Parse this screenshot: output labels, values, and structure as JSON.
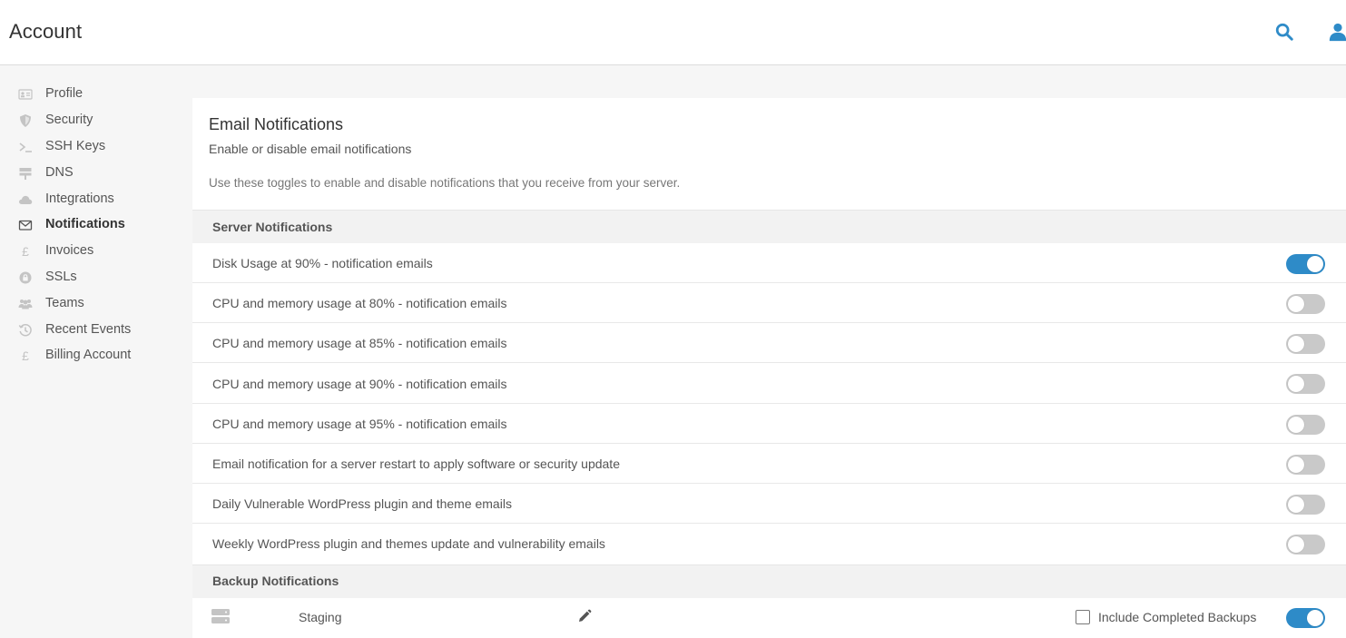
{
  "header": {
    "title": "Account",
    "search_icon": "search-icon",
    "user_icon": "user-icon",
    "accent_color": "#2e8bc8"
  },
  "sidebar": {
    "items": [
      {
        "label": "Profile",
        "icon": "id-card-icon",
        "active": false
      },
      {
        "label": "Security",
        "icon": "shield-icon",
        "active": false
      },
      {
        "label": "SSH Keys",
        "icon": "terminal-icon",
        "active": false
      },
      {
        "label": "DNS",
        "icon": "signpost-icon",
        "active": false
      },
      {
        "label": "Integrations",
        "icon": "cloud-icon",
        "active": false
      },
      {
        "label": "Notifications",
        "icon": "envelope-icon",
        "active": true
      },
      {
        "label": "Invoices",
        "icon": "pound-icon",
        "active": false
      },
      {
        "label": "SSLs",
        "icon": "lock-icon",
        "active": false
      },
      {
        "label": "Teams",
        "icon": "users-icon",
        "active": false
      },
      {
        "label": "Recent Events",
        "icon": "history-icon",
        "active": false
      },
      {
        "label": "Billing Account",
        "icon": "pound-icon",
        "active": false
      }
    ]
  },
  "panel": {
    "title": "Email Notifications",
    "subtitle": "Enable or disable email notifications",
    "description": "Use these toggles to enable and disable notifications that you receive from your server."
  },
  "server_notifications": {
    "header": "Server Notifications",
    "rows": [
      {
        "label": "Disk Usage at 90% - notification emails",
        "enabled": true
      },
      {
        "label": "CPU and memory usage at 80% - notification emails",
        "enabled": false
      },
      {
        "label": "CPU and memory usage at 85% - notification emails",
        "enabled": false
      },
      {
        "label": "CPU and memory usage at 90% - notification emails",
        "enabled": false
      },
      {
        "label": "CPU and memory usage at 95% - notification emails",
        "enabled": false
      },
      {
        "label": "Email notification for a server restart to apply software or security update",
        "enabled": false
      },
      {
        "label": "Daily Vulnerable WordPress plugin and theme emails",
        "enabled": false
      },
      {
        "label": "Weekly WordPress plugin and themes update and vulnerability emails",
        "enabled": false
      }
    ]
  },
  "backup_notifications": {
    "header": "Backup Notifications",
    "rows": [
      {
        "name": "Staging",
        "checkbox_label": "Include Completed Backups",
        "include_completed": false,
        "enabled": true
      }
    ]
  }
}
